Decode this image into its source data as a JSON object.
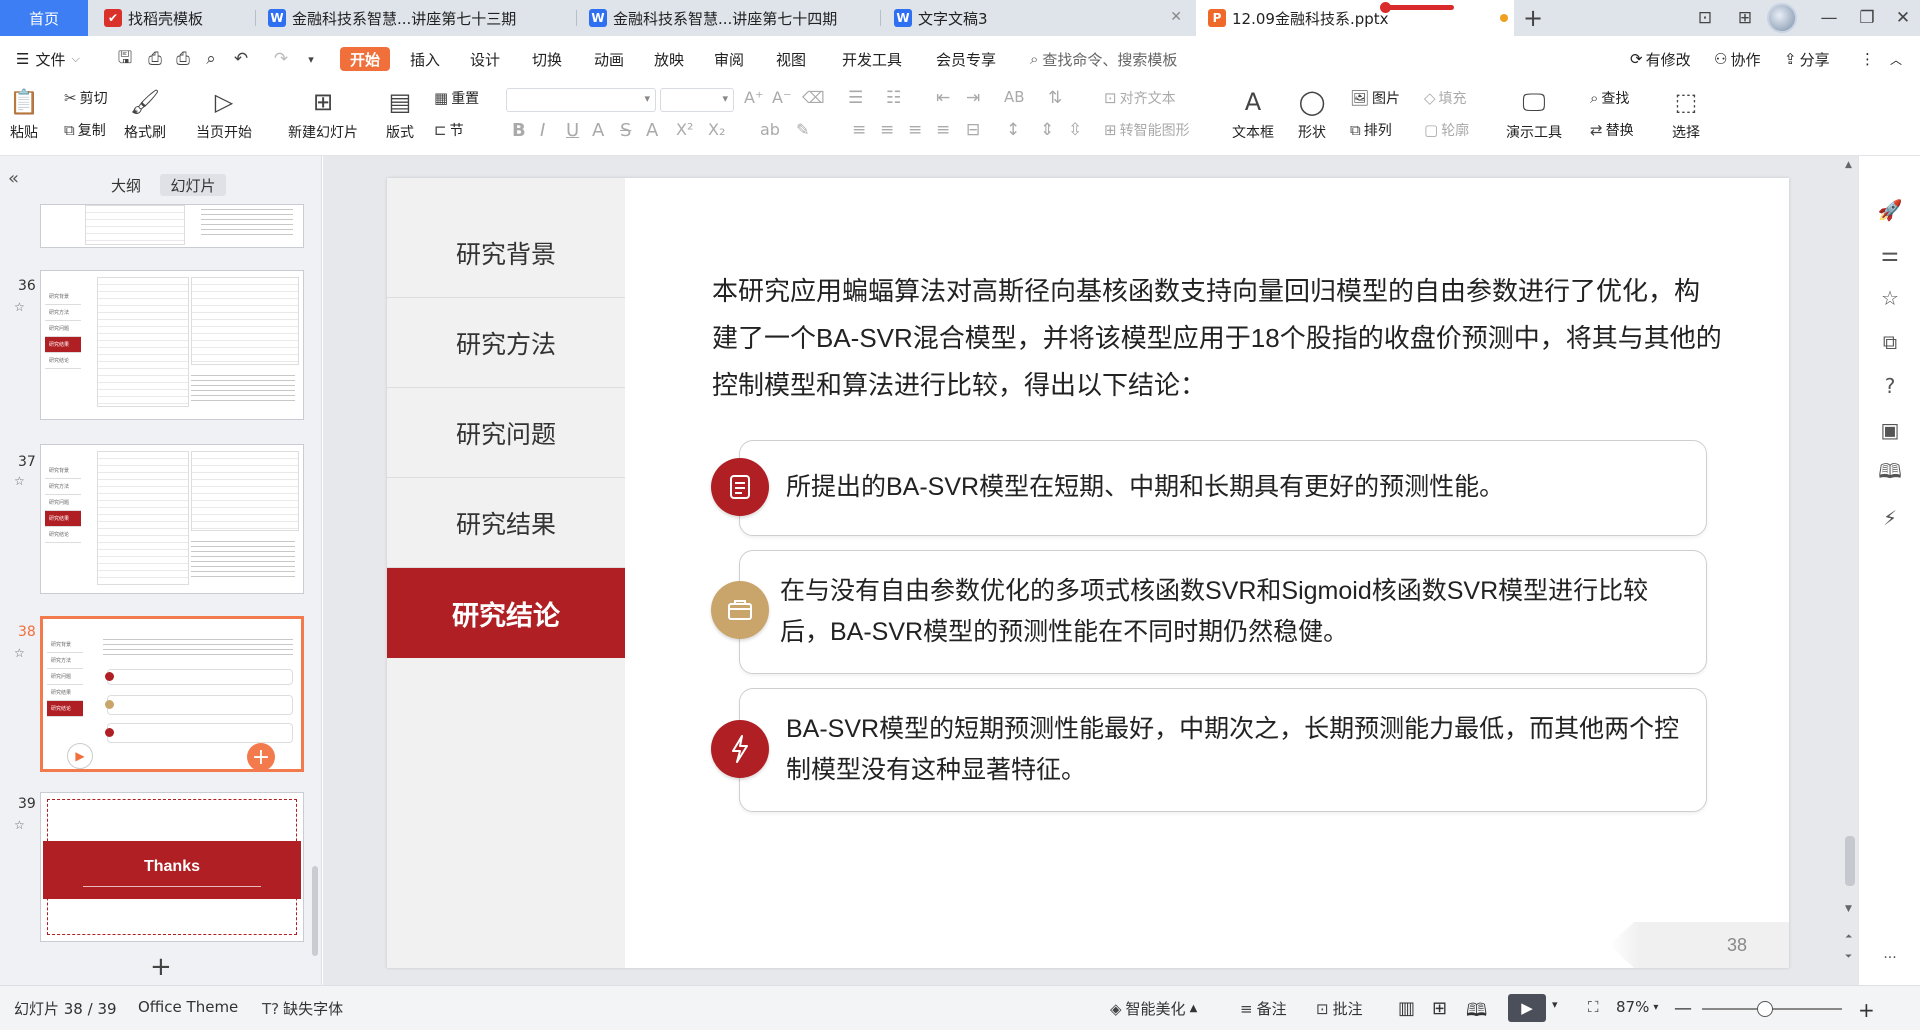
{
  "tabs": {
    "home": "首页",
    "items": [
      {
        "label": "找稻壳模板",
        "icon": "✔",
        "color": "#d9322b"
      },
      {
        "label": "金融科技系智慧...讲座第七十三期",
        "icon": "W",
        "color": "#2f6ff2"
      },
      {
        "label": "金融科技系智慧...讲座第七十四期",
        "icon": "W",
        "color": "#2f6ff2"
      },
      {
        "label": "文字文稿3",
        "icon": "W",
        "color": "#2f6ff2"
      },
      {
        "label": "12.09金融科技系.pptx",
        "icon": "P",
        "color": "#ef6a2a"
      }
    ],
    "window_controls": {
      "layout": "⊡",
      "grid": "⊞",
      "minimize": "—",
      "restore": "❐",
      "close": "✕"
    }
  },
  "menu": {
    "file": "文件",
    "items": [
      "开始",
      "插入",
      "设计",
      "切换",
      "动画",
      "放映",
      "审阅",
      "视图",
      "开发工具",
      "会员专享"
    ],
    "active": "开始",
    "search_placeholder": "查找命令、搜索模板",
    "right": [
      "有修改",
      "协作",
      "分享"
    ]
  },
  "ribbon": {
    "paste": "粘贴",
    "cut": "剪切",
    "copy": "复制",
    "format_painter": "格式刷",
    "from_current": "当页开始",
    "new_slide": "新建幻灯片",
    "layout": "版式",
    "reset": "重置",
    "section": "节",
    "align_text": "对齐文本",
    "smart_graphic": "转智能图形",
    "textbox": "文本框",
    "shape": "形状",
    "picture": "图片",
    "arrange": "排列",
    "fill": "填充",
    "outline": "轮廓",
    "presentation_tools": "演示工具",
    "find": "查找",
    "replace": "替换",
    "select": "选择",
    "format_glyphs": [
      "B",
      "I",
      "U",
      "A",
      "S",
      "A",
      "X²",
      "X₂"
    ]
  },
  "left_panel": {
    "tabs": [
      "大纲",
      "幻灯片"
    ],
    "active_tab": "幻灯片",
    "slides": [
      {
        "num": "36"
      },
      {
        "num": "37"
      },
      {
        "num": "38",
        "active": true
      },
      {
        "num": "39",
        "title": "Thanks"
      }
    ],
    "thumb_nav": [
      "研究背景",
      "研究方法",
      "研究问题",
      "研究结果",
      "研究结论"
    ]
  },
  "slide": {
    "nav": [
      "研究背景",
      "研究方法",
      "研究问题",
      "研究结果",
      "研究结论"
    ],
    "active_nav": "研究结论",
    "intro": "本研究应用蝙蝠算法对高斯径向基核函数支持向量回归模型的自由参数进行了优化，构建了一个BA-SVR混合模型，并将该模型应用于18个股指的收盘价预测中，将其与其他的控制模型和算法进行比较，得出以下结论：",
    "conclusions": [
      {
        "text": "所提出的BA-SVR模型在短期、中期和长期具有更好的预测性能。",
        "icon": "list-icon",
        "color": "#b01f24"
      },
      {
        "text": "在与没有自由参数优化的多项式核函数SVR和Sigmoid核函数SVR模型进行比较后，BA-SVR模型的预测性能在不同时期仍然稳健。",
        "icon": "box-icon",
        "color": "#c9a56b"
      },
      {
        "text": "BA-SVR模型的短期预测性能最好，中期次之，长期预测能力最低，而其他两个控制模型没有这种显著特征。",
        "icon": "bolt-icon",
        "color": "#b01f24"
      }
    ],
    "page_number": "38"
  },
  "status": {
    "slide_counter": "幻灯片 38 / 39",
    "theme": "Office Theme",
    "missing_font": "缺失字体",
    "beautify": "智能美化",
    "notes": "备注",
    "comments": "批注",
    "zoom": "87%",
    "zoom_level": 0.45
  },
  "colors": {
    "accent": "#f06f3b",
    "slide_red": "#b01f24",
    "gold": "#c9a56b",
    "home_tab": "#3d7ef5"
  }
}
